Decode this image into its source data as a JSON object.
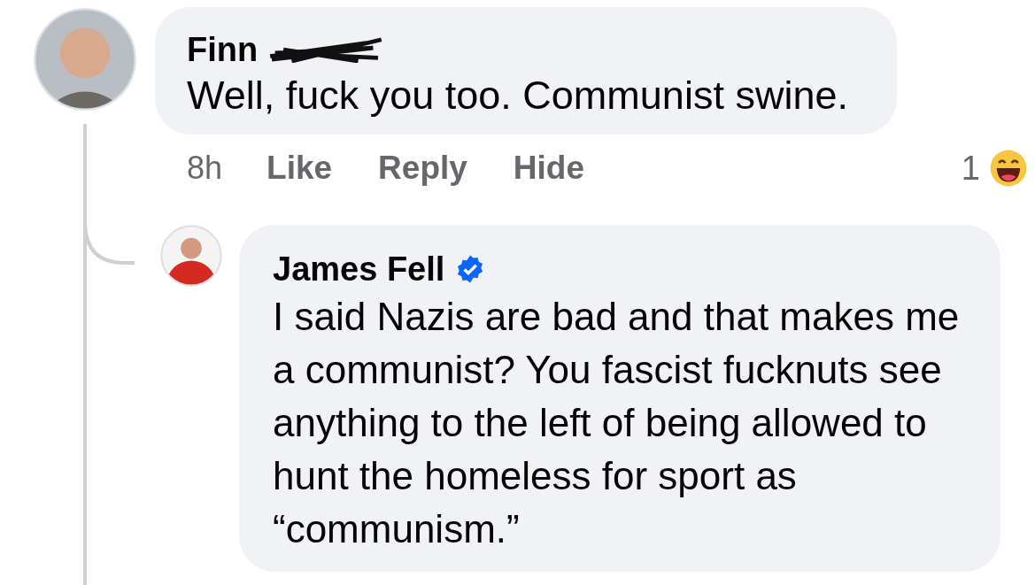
{
  "comment": {
    "author": "Finn",
    "surname_redacted": true,
    "text": "Well, fuck you too. Communist swine.",
    "time": "8h",
    "actions": [
      "Like",
      "Reply",
      "Hide"
    ],
    "reaction_count": "1",
    "replies": [
      {
        "author": "James Fell",
        "verified": true,
        "text": "I said Nazis are bad and that makes me a communist? You fascist fucknuts see anything to the left of being allowed to hunt the homeless for sport as “communism.”"
      }
    ]
  }
}
